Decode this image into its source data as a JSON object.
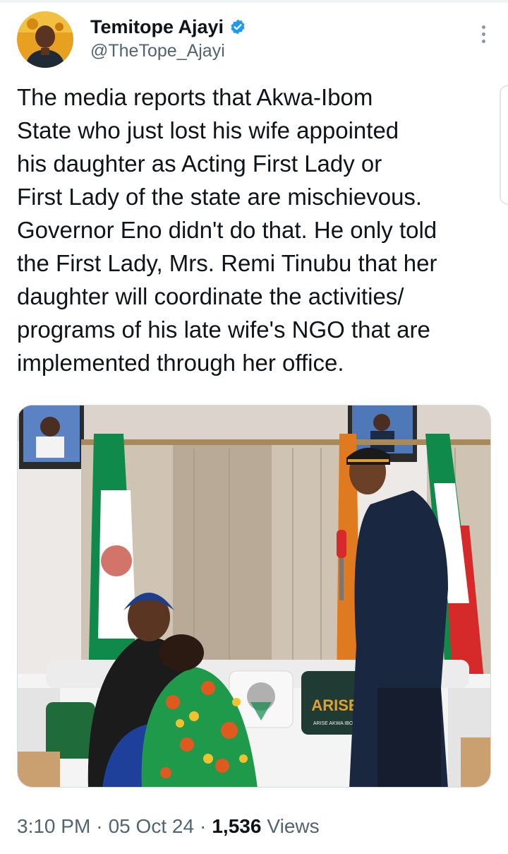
{
  "author": {
    "display_name": "Temitope Ajayi",
    "handle": "@TheTope_Ajayi",
    "verified": true,
    "avatar_icon": "profile-photo",
    "more_icon": "more-vertical-icon"
  },
  "tweet": {
    "text": "The media reports that Akwa-Ibom\nState who just lost his wife appointed\nhis daughter as Acting First Lady or\nFirst Lady of the state are mischievous.\nGovernor Eno didn't do that. He only told\nthe First Lady, Mrs. Remi Tinubu that her\ndaughter will coordinate the activities/\nprograms of his late wife's NGO that are\nimplemented through her office."
  },
  "media": {
    "pillow_text": "ARISE",
    "pillow_subtext": "ARISE AKWA IBOM"
  },
  "meta": {
    "time": "3:10 PM",
    "date": "05 Oct 24",
    "separator": "·",
    "views_count": "1,536",
    "views_label": "Views"
  },
  "colors": {
    "verified_blue": "#1d9bf0",
    "secondary_text": "#536471",
    "primary_text": "#0f1419"
  }
}
